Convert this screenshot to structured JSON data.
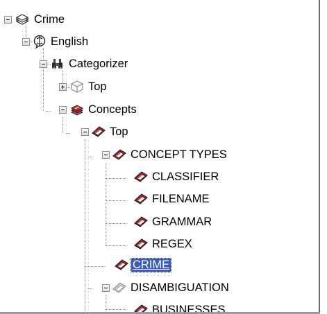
{
  "tree": {
    "nodes": [
      {
        "label": "Crime",
        "icon": "books-stack-icon",
        "toggle": "expanded"
      },
      {
        "label": "English",
        "icon": "language-globe-icon",
        "toggle": "expanded"
      },
      {
        "label": "Categorizer",
        "icon": "binoculars-icon",
        "toggle": "expanded"
      },
      {
        "label": "Top",
        "icon": "category-cube-icon",
        "toggle": "collapsed"
      },
      {
        "label": "Concepts",
        "icon": "concepts-books-icon",
        "toggle": "expanded"
      },
      {
        "label": "Top",
        "icon": "concept-icon",
        "toggle": "expanded"
      },
      {
        "label": "CONCEPT TYPES",
        "icon": "concept-icon",
        "toggle": "expanded"
      },
      {
        "label": "CLASSIFIER",
        "icon": "concept-icon",
        "toggle": "none"
      },
      {
        "label": "FILENAME",
        "icon": "concept-icon",
        "toggle": "none"
      },
      {
        "label": "GRAMMAR",
        "icon": "concept-icon",
        "toggle": "none"
      },
      {
        "label": "REGEX",
        "icon": "concept-icon",
        "toggle": "none"
      },
      {
        "label": "CRIME",
        "icon": "concept-icon",
        "toggle": "none",
        "selected": true
      },
      {
        "label": "DISAMBIGUATION",
        "icon": "disabled-concept-icon",
        "toggle": "expanded"
      },
      {
        "label": "BUSINESSES",
        "icon": "concept-icon",
        "toggle": "none"
      }
    ]
  },
  "colors": {
    "selection_background": "#3a5bc4",
    "selection_text": "#ffffff",
    "concept_red": "#d01818",
    "guide_line": "#8a8a8a"
  }
}
